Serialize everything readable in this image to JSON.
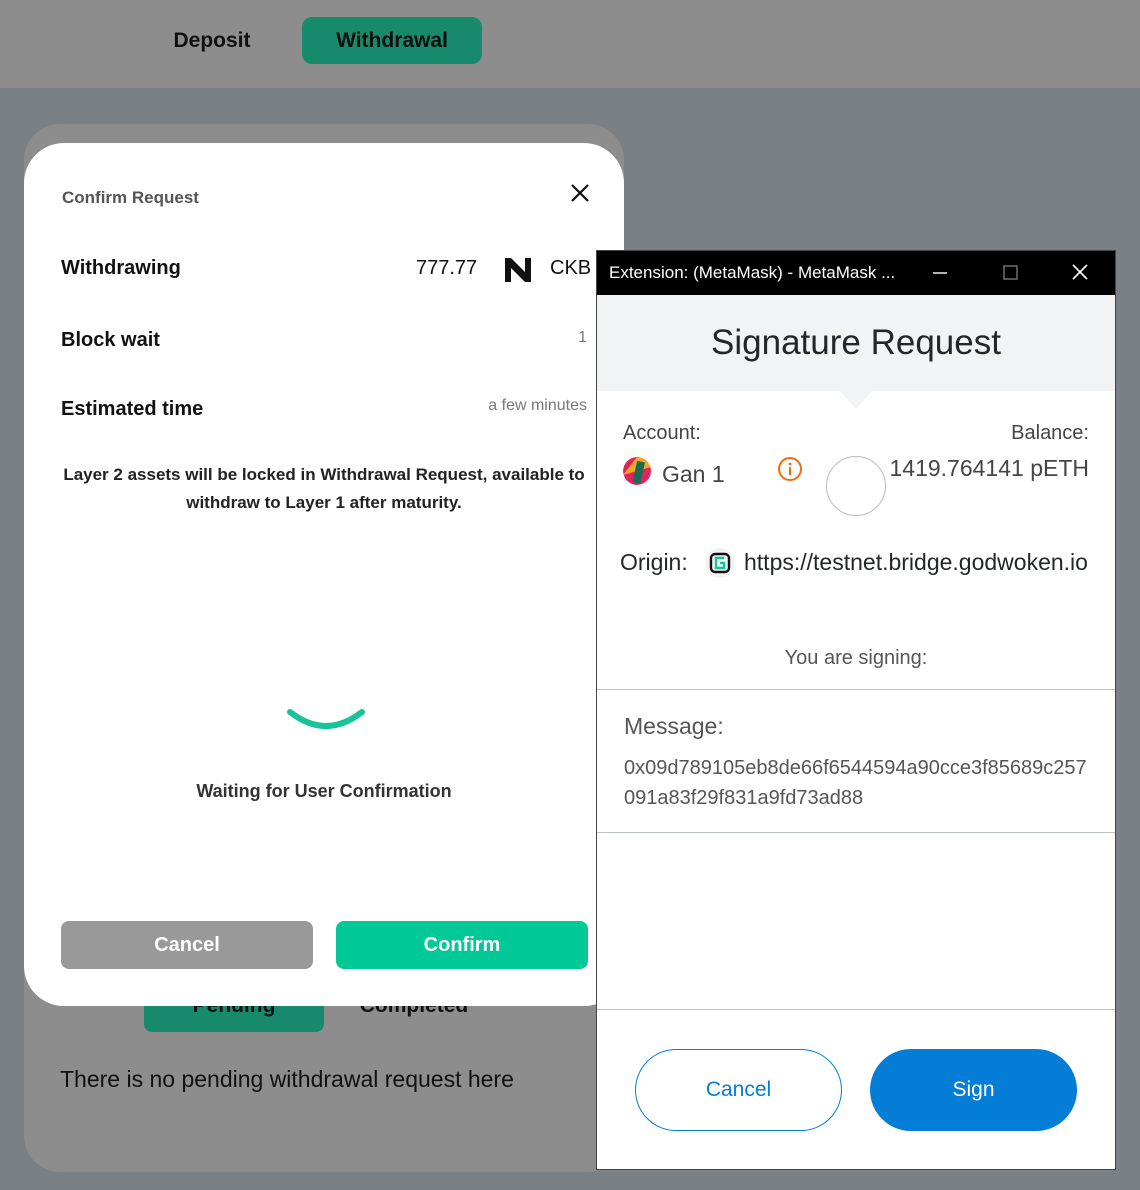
{
  "nav": {
    "deposit": "Deposit",
    "withdrawal": "Withdrawal"
  },
  "background": {
    "pending_tab": "Pending",
    "completed_tab": "Completed",
    "empty_message": "There is no pending withdrawal request here"
  },
  "confirm_modal": {
    "title": "Confirm Request",
    "withdrawing_label": "Withdrawing",
    "amount": "777.77",
    "unit": "CKB",
    "block_wait_label": "Block wait",
    "block_wait_value": "1",
    "estimated_time_label": "Estimated time",
    "estimated_time_value": "a few minutes",
    "notice": "Layer 2 assets will be locked in Withdrawal Request, available to withdraw to Layer 1 after maturity.",
    "waiting": "Waiting for User Confirmation",
    "cancel": "Cancel",
    "confirm": "Confirm",
    "colors": {
      "confirm": "#00c896",
      "cancel": "#999999"
    }
  },
  "metamask": {
    "window_title": "Extension: (MetaMask) - MetaMask ...",
    "heading": "Signature Request",
    "account_label": "Account:",
    "account_name": "Gan 1",
    "balance_label": "Balance:",
    "balance_value": "1419.764141 pETH",
    "origin_label": "Origin:",
    "origin_url": "https://testnet.bridge.godwoken.io",
    "signing_label": "You are signing:",
    "message_label": "Message:",
    "message_value": "0x09d789105eb8de66f6544594a90cce3f85689c257091a83f29f831a9fd73ad88",
    "cancel": "Cancel",
    "sign": "Sign",
    "colors": {
      "primary": "#037dd6"
    },
    "icons": [
      "minimize-icon",
      "maximize-icon",
      "close-icon",
      "info-icon"
    ]
  }
}
